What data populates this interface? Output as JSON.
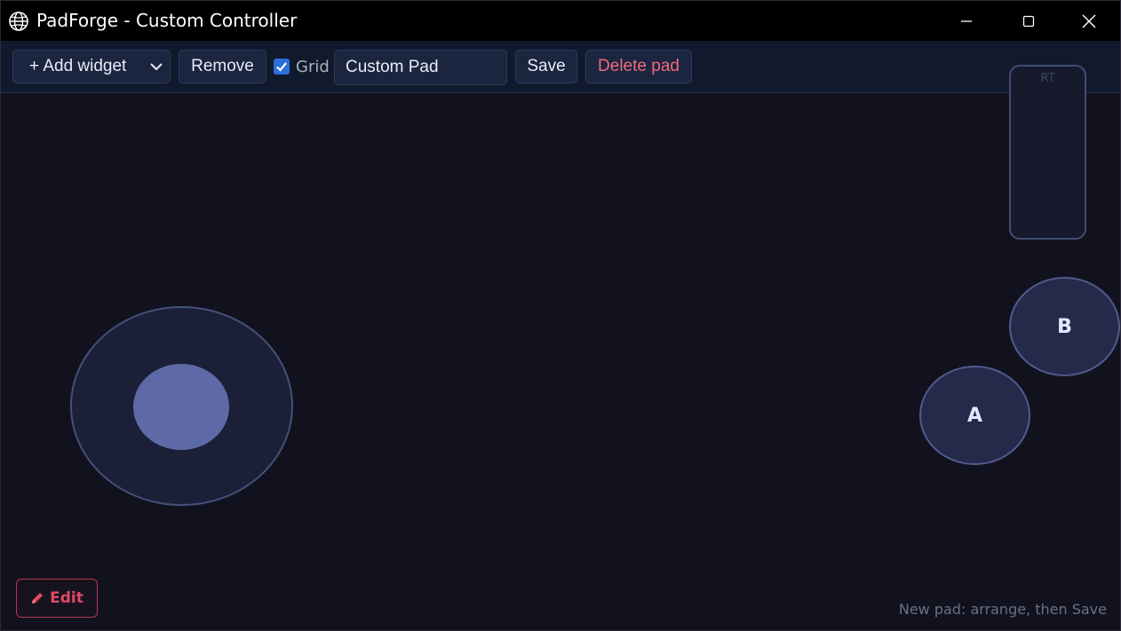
{
  "window": {
    "title": "PadForge - Custom Controller",
    "app_icon": "globe-icon"
  },
  "toolbar": {
    "add_widget_label": "+ Add widget",
    "remove_label": "Remove",
    "grid_label": "Grid",
    "grid_checked": true,
    "pad_name_value": "Custom Pad",
    "save_label": "Save",
    "delete_label": "Delete pad"
  },
  "canvas": {
    "slider_label": "RT",
    "button_a_label": "A",
    "button_b_label": "B"
  },
  "footer": {
    "edit_label": "Edit",
    "edit_icon": "pencil-icon",
    "status_text": "New pad: arrange, then Save"
  },
  "colors": {
    "accent_blue": "#2b6fdc",
    "danger": "#f06a7c",
    "edit_red": "#e04a66"
  }
}
